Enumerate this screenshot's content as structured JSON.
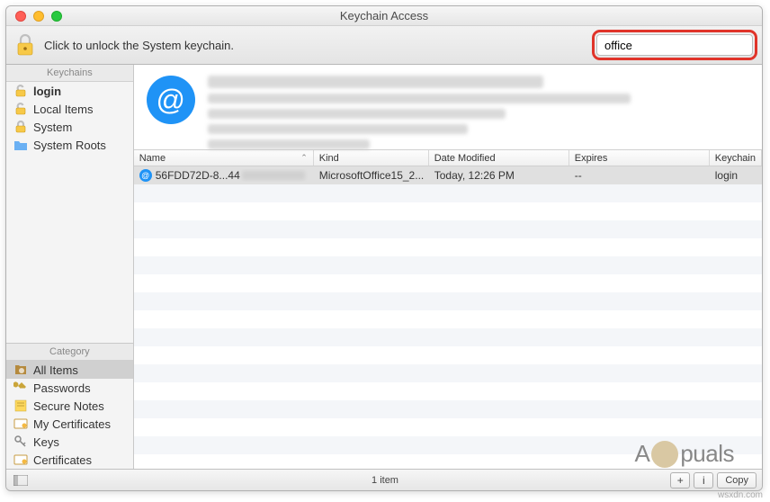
{
  "window": {
    "title": "Keychain Access"
  },
  "toolbar": {
    "unlock_text": "Click to unlock the System keychain.",
    "search_value": "office"
  },
  "sidebar": {
    "keychains_header": "Keychains",
    "keychains": [
      {
        "label": "login",
        "bold": true
      },
      {
        "label": "Local Items"
      },
      {
        "label": "System"
      },
      {
        "label": "System Roots"
      }
    ],
    "category_header": "Category",
    "categories": [
      {
        "label": "All Items",
        "selected": true
      },
      {
        "label": "Passwords"
      },
      {
        "label": "Secure Notes"
      },
      {
        "label": "My Certificates"
      },
      {
        "label": "Keys"
      },
      {
        "label": "Certificates"
      }
    ]
  },
  "table": {
    "headers": {
      "name": "Name",
      "kind": "Kind",
      "date": "Date Modified",
      "expires": "Expires",
      "keychain": "Keychain"
    },
    "rows": [
      {
        "name": "56FDD72D-8...44",
        "kind": "MicrosoftOffice15_2...",
        "date": "Today, 12:26 PM",
        "expires": "--",
        "keychain": "login"
      }
    ]
  },
  "statusbar": {
    "copy_label": "Copy",
    "item_count": "1 item"
  },
  "watermark": {
    "text_left": "A",
    "text_right": "puals"
  },
  "attribution": "wsxdn.com"
}
